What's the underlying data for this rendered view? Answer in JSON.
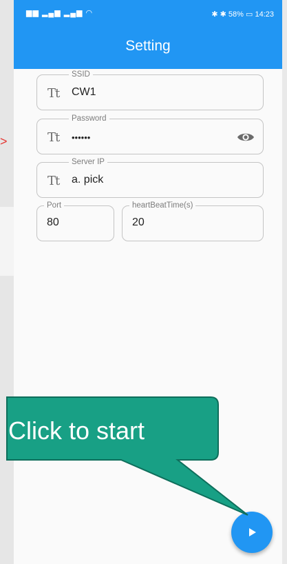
{
  "statusbar": {
    "left_icons": "▆▆ ▂▄▆ ▂▄▆ ◠",
    "right_text": "✱ ✱ 58% ▭ 14:23"
  },
  "appbar": {
    "title": "Setting"
  },
  "form": {
    "ssid": {
      "label": "SSID",
      "value": "CW1"
    },
    "password": {
      "label": "Password",
      "value": "••••••"
    },
    "server_ip": {
      "label": "Server IP",
      "value": "a. pick"
    },
    "port": {
      "label": "Port",
      "value": "80"
    },
    "heartbeat": {
      "label": "heartBeatTime(s)",
      "value": "20"
    }
  },
  "icons": {
    "text_field": "Tt",
    "visibility": "eye-icon",
    "play": "play-icon"
  },
  "callout": {
    "text": "Click to start"
  },
  "colors": {
    "primary": "#2196f3",
    "callout": "#18a085",
    "callout_border": "#0e6e5b"
  }
}
